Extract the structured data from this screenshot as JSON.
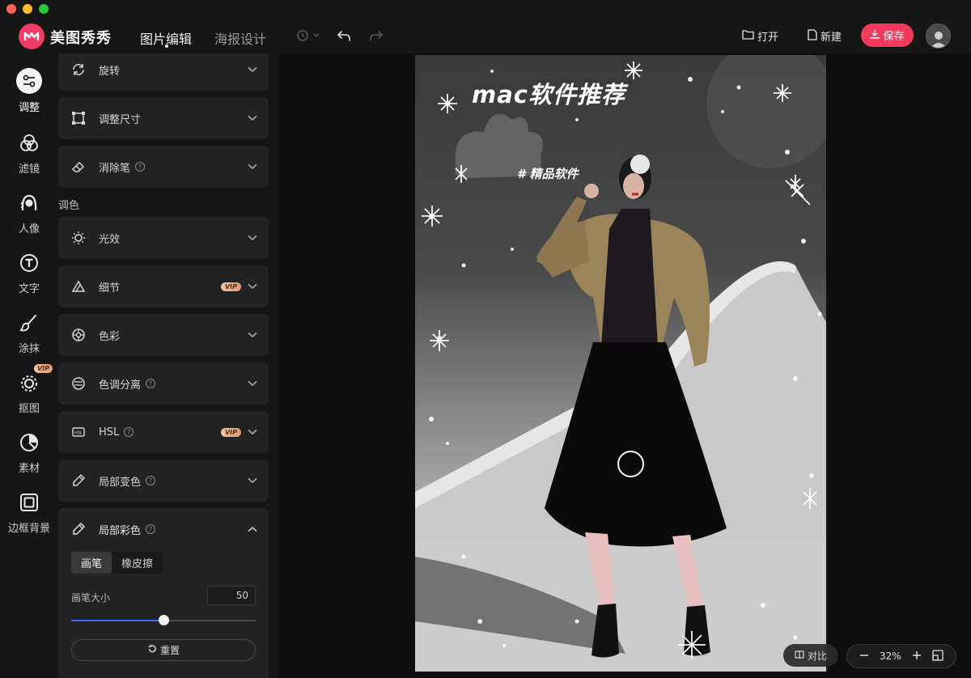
{
  "app": {
    "name": "美图秀秀",
    "tabs": [
      "图片编辑",
      "海报设计"
    ],
    "active_tab": 0
  },
  "toolbar": {
    "open_label": "打开",
    "new_label": "新建",
    "save_label": "保存"
  },
  "rail": {
    "items": [
      {
        "label": "调整",
        "icon": "sliders-icon",
        "active": true
      },
      {
        "label": "滤镜",
        "icon": "filter-icon"
      },
      {
        "label": "人像",
        "icon": "portrait-icon"
      },
      {
        "label": "文字",
        "icon": "text-icon"
      },
      {
        "label": "涂抹",
        "icon": "brush-icon"
      },
      {
        "label": "抠图",
        "icon": "cutout-icon",
        "badge": "VIP"
      },
      {
        "label": "素材",
        "icon": "sticker-icon"
      },
      {
        "label": "边框背景",
        "icon": "frame-icon"
      }
    ]
  },
  "panel": {
    "cards": [
      {
        "label": "旋转",
        "icon": "rotate-icon"
      },
      {
        "label": "调整尺寸",
        "icon": "resize-icon"
      },
      {
        "label": "消除笔",
        "icon": "eraser-icon",
        "help": "?"
      },
      {
        "label": "光效",
        "icon": "sun-icon"
      },
      {
        "label": "细节",
        "icon": "detail-icon",
        "vip": "VIP"
      },
      {
        "label": "色彩",
        "icon": "color-wheel-icon"
      },
      {
        "label": "色调分离",
        "icon": "split-tone-icon",
        "help": "?"
      },
      {
        "label": "HSL",
        "icon": "hsl-icon",
        "help": "?",
        "vip": "VIP"
      },
      {
        "label": "局部变色",
        "icon": "color-pen-icon",
        "help": "?"
      }
    ],
    "section_label": "调色",
    "expanded": {
      "label": "局部彩色",
      "icon": "color-pen-icon",
      "help": "?",
      "modes": [
        "画笔",
        "橡皮擦"
      ],
      "active_mode": 0,
      "brush_size_label": "画笔大小",
      "brush_size_value": "50",
      "brush_size_fraction": 0.5,
      "reset_label": "重置"
    }
  },
  "canvas": {
    "overlay_title": "mac软件推荐",
    "overlay_subtitle": "# 精品软件",
    "compare_label": "对比",
    "zoom": "32%"
  },
  "colors": {
    "accent": "#f23a5c",
    "slider": "#3b6cff",
    "vip": "#d99a74"
  }
}
